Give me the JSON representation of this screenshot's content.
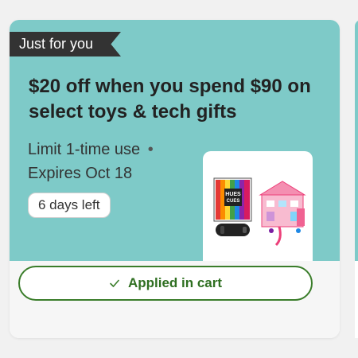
{
  "offer": {
    "ribbon": "Just for you",
    "headline": "$20 off when you spend $90 on select toys & tech gifts",
    "limit_text": "Limit 1-time use",
    "bullet": "•",
    "expires_text": "Expires Oct 18",
    "days_left_badge": "6 days left",
    "applied_button_label": "Applied in cart",
    "applied_icon": "check-icon",
    "product_image_icon": "toys-tech-product-image",
    "product_game_title_1": "HUES",
    "product_game_title_2": "CUES"
  },
  "colors": {
    "card_top_bg": "#7ecac8",
    "ribbon_bg": "#333333",
    "applied_green": "#3a7d2a",
    "page_bg": "#f1f1f1"
  }
}
